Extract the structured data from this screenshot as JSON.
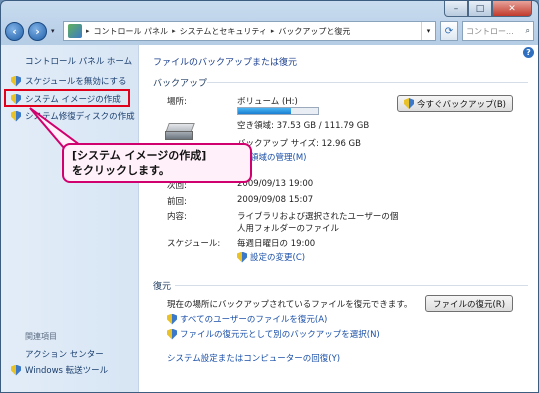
{
  "window": {
    "minimize": "–",
    "maximize": "□",
    "close": "✕"
  },
  "address": {
    "crumbs": [
      "コントロール パネル",
      "システムとセキュリティ",
      "バックアップと復元"
    ],
    "search_placeholder": "コントロー..."
  },
  "sidebar": {
    "home": "コントロール パネル ホーム",
    "items": [
      {
        "label": "スケジュールを無効にする"
      },
      {
        "label": "システム イメージの作成"
      },
      {
        "label": "システム修復ディスクの作成"
      }
    ],
    "related_heading": "関連項目",
    "related": [
      {
        "label": "アクション センター"
      },
      {
        "label": "Windows 転送ツール"
      }
    ]
  },
  "main": {
    "title": "ファイルのバックアップまたは復元",
    "backup_heading": "バックアップ",
    "location_label": "場所:",
    "location_value": "ボリューム (H:)",
    "free_space": "空き領域: 37.53 GB / 111.79 GB",
    "used_fraction": 0.66,
    "backup_size": "バックアップ サイズ: 12.96 GB",
    "manage_space": "領域の管理(M)",
    "backup_now": "今すぐバックアップ(B)",
    "next_label": "次回:",
    "next_value": "2009/09/13 19:00",
    "last_label": "前回:",
    "last_value": "2009/09/08 15:07",
    "contents_label": "内容:",
    "contents_line1": "ライブラリおよび選択されたユーザーの個",
    "contents_line2": "人用フォルダーのファイル",
    "schedule_label": "スケジュール:",
    "schedule_value": "毎週日曜日の 19:00",
    "change_settings": "設定の変更(C)",
    "restore_heading": "復元",
    "restore_text": "現在の場所にバックアップされているファイルを復元できます。",
    "restore_button": "ファイルの復元(R)",
    "restore_all": "すべてのユーザーのファイルを復元(A)",
    "select_other": "ファイルの復元元として別のバックアップを選択(N)",
    "recover_system": "システム設定またはコンピューターの回復(Y)"
  },
  "callout": {
    "line1": "[システム イメージの作成]",
    "line2": "をクリックします。"
  },
  "colors": {
    "highlight": "#e0001b",
    "callout_border": "#d0006f",
    "link": "#1a4fa8"
  }
}
